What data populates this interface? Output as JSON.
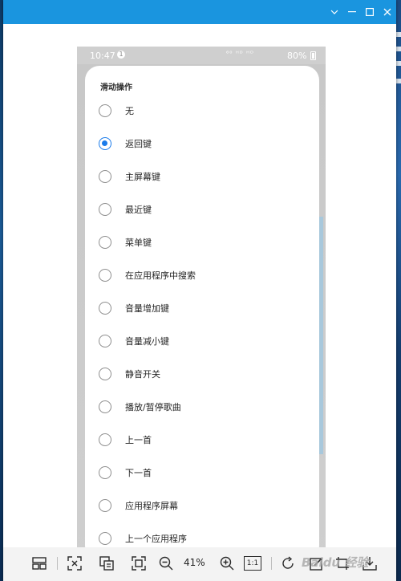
{
  "phone_status": {
    "time": "10:47",
    "notification_badge": "1",
    "network_icons": "⁶⁰ ᴴᴰ ᴴᴰ",
    "battery": "80%"
  },
  "dialog": {
    "title": "滑动操作",
    "selected_index": 1,
    "options": [
      "无",
      "返回键",
      "主屏幕键",
      "最近键",
      "菜单键",
      "在应用程序中搜索",
      "音量增加键",
      "音量减小键",
      "静音开关",
      "播放/暂停歌曲",
      "上一首",
      "下一首",
      "应用程序屏幕",
      "上一个应用程序"
    ]
  },
  "toolbar": {
    "zoom": "41%",
    "actual_size": "1:1",
    "watermark": "Baidu 经验",
    "icons": [
      "layout-icon",
      "fit-window-icon",
      "ocr-icon",
      "fullscreen-icon",
      "zoom-out-icon",
      "zoom-in-icon",
      "actual-size-icon",
      "rotate-icon",
      "edit-icon",
      "crop-icon",
      "download-icon"
    ]
  },
  "window": {
    "controls": [
      "minimize-chevron",
      "minimize",
      "maximize",
      "close"
    ]
  },
  "colors": {
    "titlebar": "#1a95df",
    "radio_selected": "#1a7bea"
  }
}
